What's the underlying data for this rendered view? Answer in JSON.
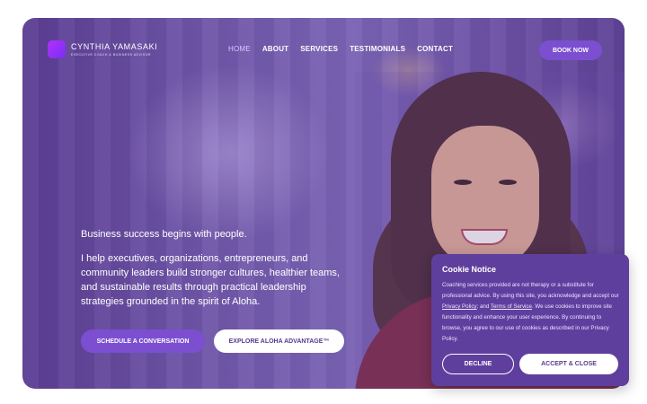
{
  "brand": {
    "name": "CYNTHIA YAMASAKI",
    "tagline": "EXECUTIVE COACH & BUSINESS ADVISOR"
  },
  "nav": {
    "items": [
      {
        "label": "HOME"
      },
      {
        "label": "ABOUT"
      },
      {
        "label": "SERVICES"
      },
      {
        "label": "TESTIMONIALS"
      },
      {
        "label": "CONTACT"
      }
    ],
    "book_label": "BOOK NOW"
  },
  "hero": {
    "lead": "Business success begins with people.",
    "body": "I help executives, organizations, entrepreneurs, and community leaders build stronger cultures, healthier teams, and sustainable results through practical leadership strategies grounded in the spirit of Aloha.",
    "primary_cta": "SCHEDULE A CONVERSATION",
    "secondary_cta": "EXPLORE ALOHA ADVANTAGE™"
  },
  "cookie": {
    "title": "Cookie Notice",
    "text_1": "Coaching services provided are not therapy or a substitute for professional advice. By using this site, you acknowledge and accept our ",
    "privacy_link": "Privacy Policy",
    "text_2": "; and ",
    "terms_link": "Terms of Service",
    "text_3": ". We use cookies to improve site functionality and enhance your user experience. By continuing to browse, you agree to our use of cookies as described in our Privacy Policy.",
    "decline_label": "DECLINE",
    "accept_label": "ACCEPT & CLOSE"
  },
  "colors": {
    "accent": "#7b4fd0",
    "overlay": "#6a4fa6",
    "cookie_bg": "#5f3f9e"
  }
}
